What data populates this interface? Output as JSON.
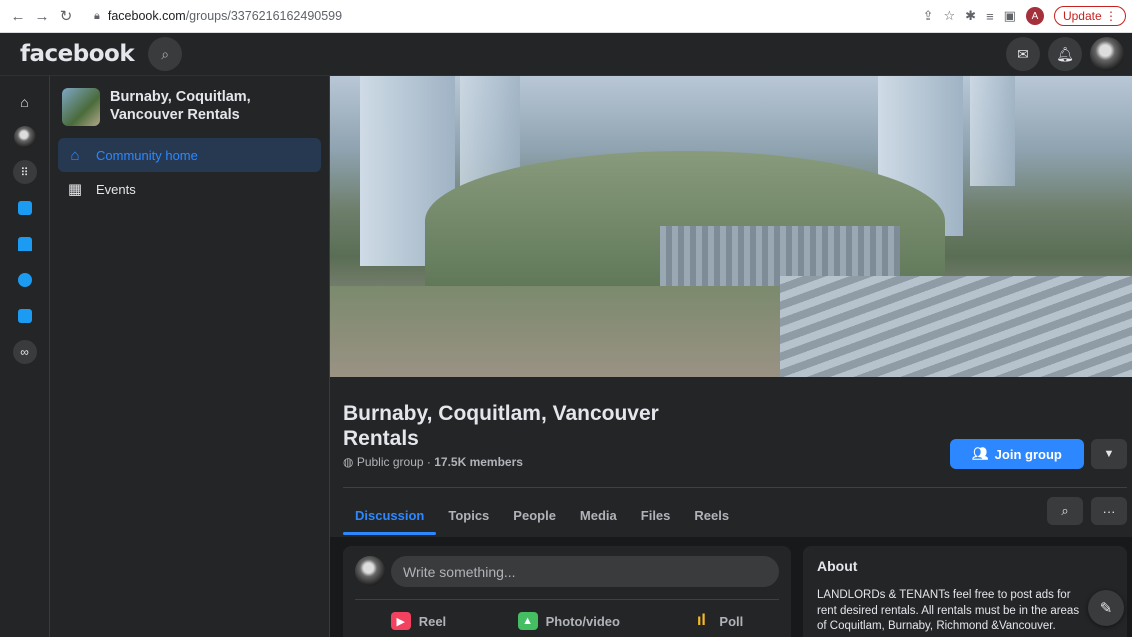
{
  "browser": {
    "url_host": "facebook.com",
    "url_path": "/groups/3376216162490599",
    "profile_initial": "A",
    "update_label": "Update"
  },
  "topbar": {
    "logo": "facebook"
  },
  "sidebar": {
    "group_name": "Burnaby, Coquitlam, Vancouver Rentals",
    "items": [
      {
        "label": "Community home",
        "icon": "house-icon",
        "active": true
      },
      {
        "label": "Events",
        "icon": "calendar-grid-icon",
        "active": false
      }
    ]
  },
  "group": {
    "title": "Burnaby, Coquitlam, Vancouver Rentals",
    "privacy": "Public group",
    "separator": " · ",
    "members": "17.5K members",
    "join_label": "Join group"
  },
  "tabs": [
    "Discussion",
    "Topics",
    "People",
    "Media",
    "Files",
    "Reels"
  ],
  "composer": {
    "placeholder": "Write something...",
    "actions": [
      {
        "label": "Reel",
        "icon": "reel-icon",
        "color": "#f3425f"
      },
      {
        "label": "Photo/video",
        "icon": "photo-icon",
        "color": "#45bd62"
      },
      {
        "label": "Poll",
        "icon": "poll-icon",
        "color": "#f7b928"
      }
    ]
  },
  "about": {
    "heading": "About",
    "text": "LANDLORDs & TENANTs feel free to post ads for rent desired rentals. All rentals must be in the areas of Coquitlam, Burnaby, Richmond &Vancouver."
  },
  "colors": {
    "accent": "#2d88ff",
    "surface": "#242526",
    "background": "#18191a"
  }
}
